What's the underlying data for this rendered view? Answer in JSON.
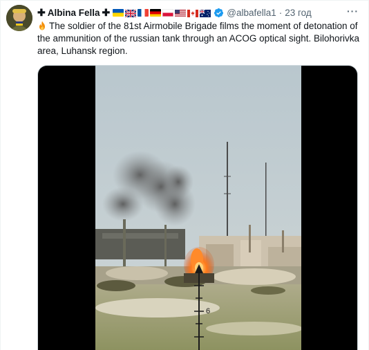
{
  "author": {
    "display_name": "Albina Fella",
    "cross_symbol": "✚",
    "handle": "@albafella1",
    "separator": "·",
    "time": "23 год",
    "verified": true,
    "flags": [
      "ukraine",
      "united-kingdom",
      "france",
      "germany",
      "poland",
      "united-states",
      "canada",
      "australia"
    ]
  },
  "menu": {
    "more_label": "···"
  },
  "tweet": {
    "text": "The soldier of the 81st Airmobile Brigade films the moment of detonation of the ammunition of the russian tank through an ACOG optical sight. Bilohorivka area, Luhansk region.",
    "leading_emoji": "fire-icon"
  },
  "media": {
    "type": "video",
    "scope_reticle_label": "6"
  },
  "colors": {
    "text": "#0f1419",
    "secondary_text": "#536471",
    "verified_blue": "#1d9bf0",
    "border": "#eff3f4"
  }
}
